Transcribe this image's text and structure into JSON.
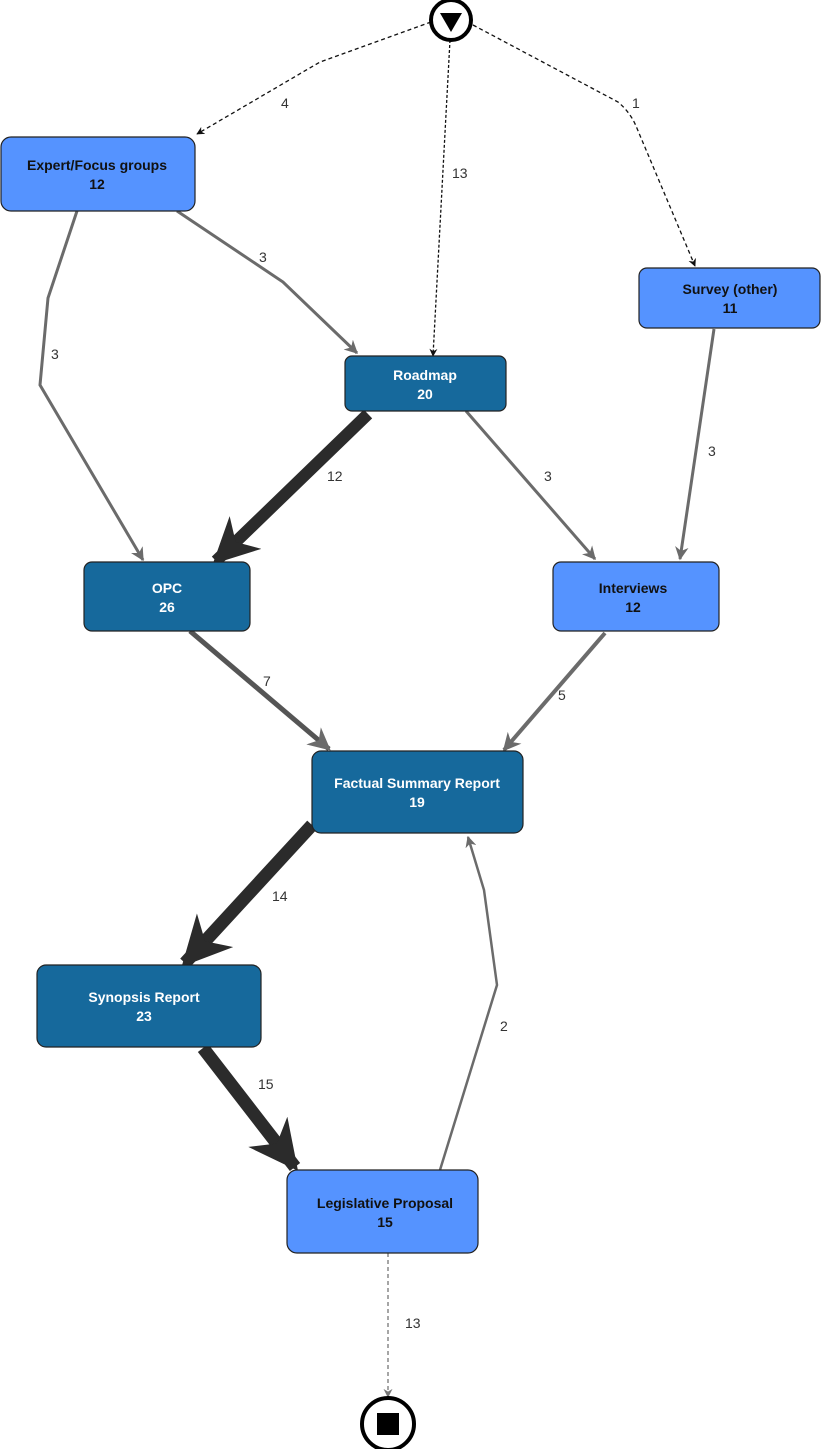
{
  "colors": {
    "light_node": "#5593ff",
    "dark_node": "#16699c",
    "edge": "#6b6b6b",
    "heavy_edge": "#2b2b2b"
  },
  "start_event": {
    "icon": "triangle-down-icon"
  },
  "end_event": {
    "icon": "square-stop-icon"
  },
  "nodes": [
    {
      "id": "expert",
      "name": "Expert/Focus groups",
      "count": "12",
      "style": "light"
    },
    {
      "id": "survey",
      "name": "Survey (other)",
      "count": "11",
      "style": "light"
    },
    {
      "id": "roadmap",
      "name": "Roadmap",
      "count": "20",
      "style": "dark"
    },
    {
      "id": "opc",
      "name": "OPC",
      "count": "26",
      "style": "dark"
    },
    {
      "id": "interviews",
      "name": "Interviews",
      "count": "12",
      "style": "light"
    },
    {
      "id": "fsr",
      "name": "Factual Summary Report",
      "count": "19",
      "style": "dark"
    },
    {
      "id": "synopsis",
      "name": "Synopsis Report",
      "count": "23",
      "style": "dark"
    },
    {
      "id": "legprop",
      "name": "Legislative Proposal",
      "count": "15",
      "style": "light"
    }
  ],
  "edges": [
    {
      "from": "start",
      "to": "expert",
      "label": "4"
    },
    {
      "from": "start",
      "to": "roadmap",
      "label": "13"
    },
    {
      "from": "start",
      "to": "survey",
      "label": "1"
    },
    {
      "from": "expert",
      "to": "roadmap",
      "label": "3"
    },
    {
      "from": "expert",
      "to": "opc",
      "label": "3"
    },
    {
      "from": "roadmap",
      "to": "opc",
      "label": "12"
    },
    {
      "from": "roadmap",
      "to": "interviews",
      "label": "3"
    },
    {
      "from": "survey",
      "to": "interviews",
      "label": "3"
    },
    {
      "from": "opc",
      "to": "fsr",
      "label": "7"
    },
    {
      "from": "interviews",
      "to": "fsr",
      "label": "5"
    },
    {
      "from": "fsr",
      "to": "synopsis",
      "label": "14"
    },
    {
      "from": "synopsis",
      "to": "legprop",
      "label": "15"
    },
    {
      "from": "legprop",
      "to": "fsr",
      "label": "2"
    },
    {
      "from": "legprop",
      "to": "end",
      "label": "13"
    }
  ]
}
